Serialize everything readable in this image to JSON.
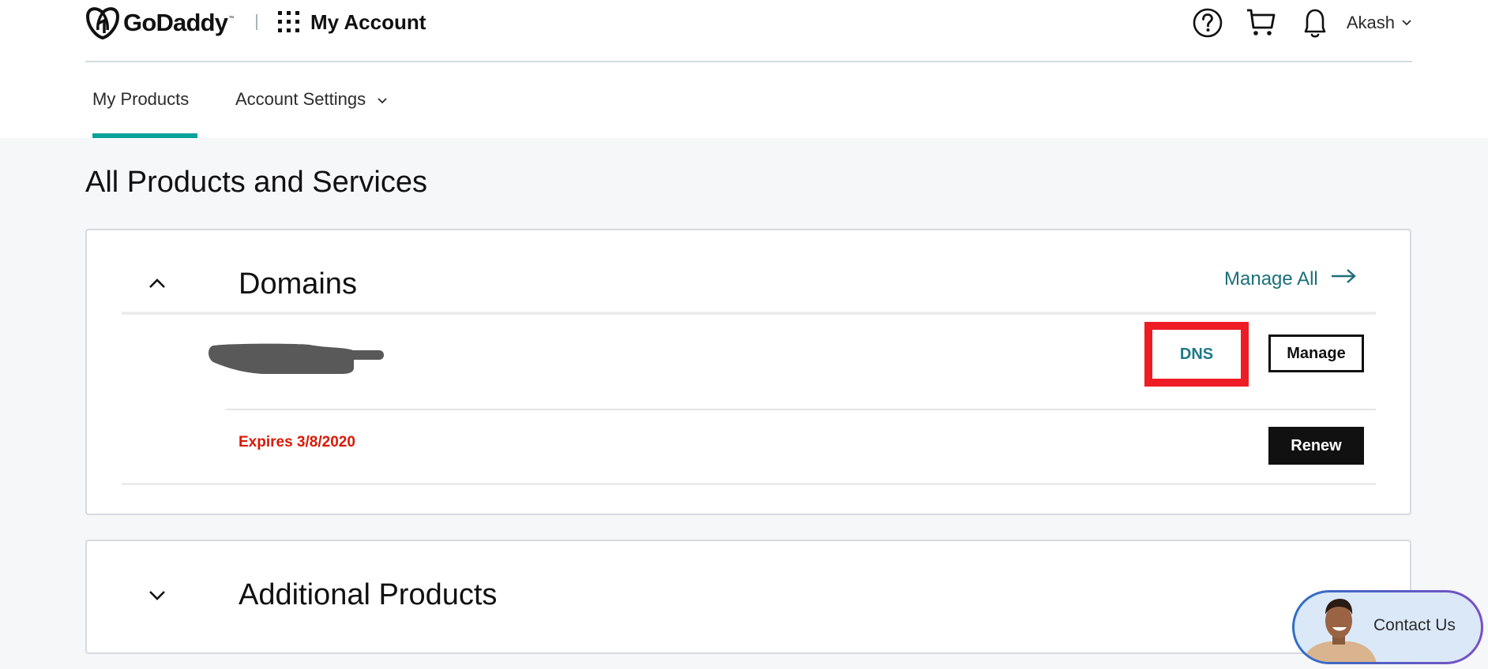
{
  "header": {
    "brand": "GoDaddy",
    "brand_tm": "™",
    "app_title": "My Account",
    "icons": [
      "help-icon",
      "cart-icon",
      "bell-icon"
    ],
    "user_name": "Akash"
  },
  "tabs": [
    {
      "label": "My Products",
      "active": true
    },
    {
      "label": "Account Settings",
      "has_dropdown": true
    }
  ],
  "page": {
    "title": "All Products and Services"
  },
  "sections": {
    "domains": {
      "title": "Domains",
      "expanded": true,
      "manage_all_label": "Manage All",
      "domain_name": "[redacted]",
      "dns_label": "DNS",
      "manage_label": "Manage",
      "expires_text": "Expires 3/8/2020",
      "renew_label": "Renew"
    },
    "additional": {
      "title": "Additional Products",
      "expanded": false
    }
  },
  "contact": {
    "label": "Contact Us"
  },
  "colors": {
    "accent_teal": "#09a39a",
    "link_teal": "#1b6f79",
    "expire_red": "#db1802",
    "highlight_red": "#ee1c25",
    "page_bg": "#f5f7f8"
  }
}
